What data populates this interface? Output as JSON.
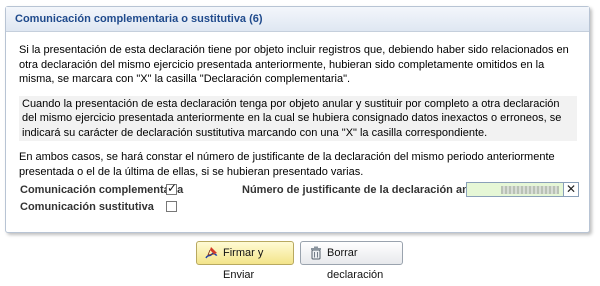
{
  "panel": {
    "title": "Comunicación complementaria o sustitutiva (6)",
    "para1": "Si la presentación de esta declaración tiene por objeto incluir registros que, debiendo haber sido relacionados en otra declaración del mismo ejercicio presentada anteriormente, hubieran sido completamente omitidos en la misma, se marcara con \"X\" la casilla \"Declaración complementaria\".",
    "para2": "Cuando la presentación de esta declaración tenga por objeto anular y sustituir por completo a otra declaración del mismo ejercicio presentada anteriormente en la cual se hubiera consignado datos inexactos o erroneos, se indicará su carácter de declaración sustitutiva marcando con una \"X\" la casilla correspondiente.",
    "para3": "En ambos casos, se hará constar el número de justificante de la declaración del mismo periodo anteriormente presentada o el de la última de ellas, si se hubieran presentado varias."
  },
  "form": {
    "complementaria_label": "Comunicación complementaria",
    "complementaria_checked": true,
    "sustitutiva_label": "Comunicación sustitutiva",
    "sustitutiva_checked": false,
    "justificante_label": "Número de justificante de la declaración anterior",
    "clear_field_glyph": "✕"
  },
  "buttons": {
    "sign_label": "Firmar y Enviar",
    "sign_icon": "pen-signature-icon",
    "delete_label": "Borrar declaración",
    "delete_icon": "trash-icon"
  },
  "colors": {
    "header_text": "#1f4a8c",
    "field_bg": "#e6f7d6",
    "sign_button": "#f3e48a"
  }
}
